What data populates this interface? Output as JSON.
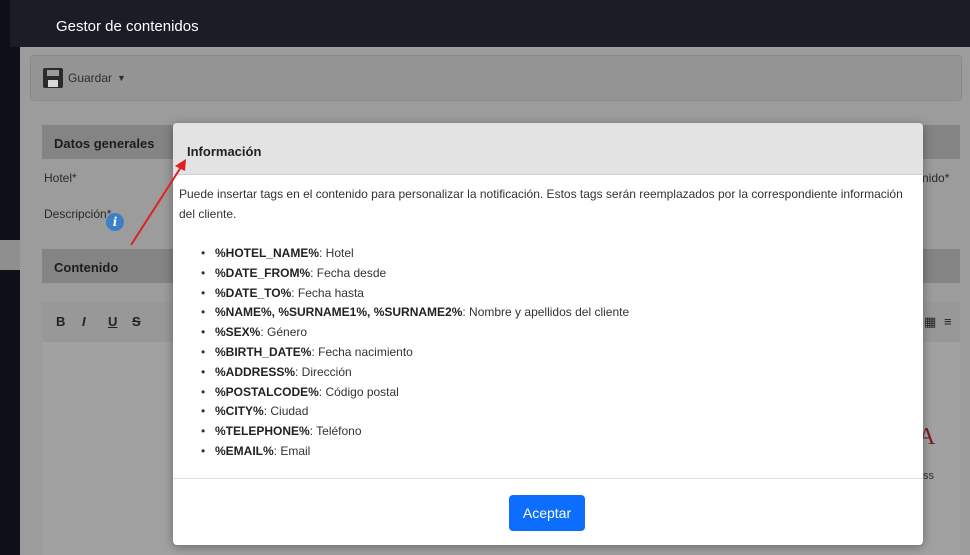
{
  "app": {
    "title": "Gestor de contenidos"
  },
  "toolbar": {
    "save_label": "Guardar"
  },
  "sections": {
    "general": "Datos generales",
    "content": "Contenido"
  },
  "fields": {
    "hotel": "Hotel*",
    "description": "Descripción*",
    "right_cut": "nido*"
  },
  "editor": {
    "big_letter": "A",
    "fragment": "ss"
  },
  "modal": {
    "title": "Información",
    "intro": "Puede insertar tags en el contenido para personalizar la notificación. Estos tags serán reemplazados por la correspondiente información del cliente.",
    "tags": [
      {
        "tag": "%HOTEL_NAME%",
        "desc": ": Hotel"
      },
      {
        "tag": "%DATE_FROM%",
        "desc": ": Fecha desde"
      },
      {
        "tag": "%DATE_TO%",
        "desc": ": Fecha hasta"
      },
      {
        "tag": "%NAME%, %SURNAME1%, %SURNAME2%",
        "desc": ": Nombre y apellidos del cliente"
      },
      {
        "tag": "%SEX%",
        "desc": ": Género"
      },
      {
        "tag": "%BIRTH_DATE%",
        "desc": ": Fecha nacimiento"
      },
      {
        "tag": "%ADDRESS%",
        "desc": ": Dirección"
      },
      {
        "tag": "%POSTALCODE%",
        "desc": ": Código postal"
      },
      {
        "tag": "%CITY%",
        "desc": ": Ciudad"
      },
      {
        "tag": "%TELEPHONE%",
        "desc": ": Teléfono"
      },
      {
        "tag": "%EMAIL%",
        "desc": ": Email"
      }
    ],
    "ok_label": "Aceptar"
  },
  "colors": {
    "accent": "#0d6efd",
    "arrow": "#e02020"
  },
  "icons": [
    "floppy-disk-icon",
    "caret-down-icon",
    "info-icon",
    "table-icon",
    "align-icon"
  ]
}
